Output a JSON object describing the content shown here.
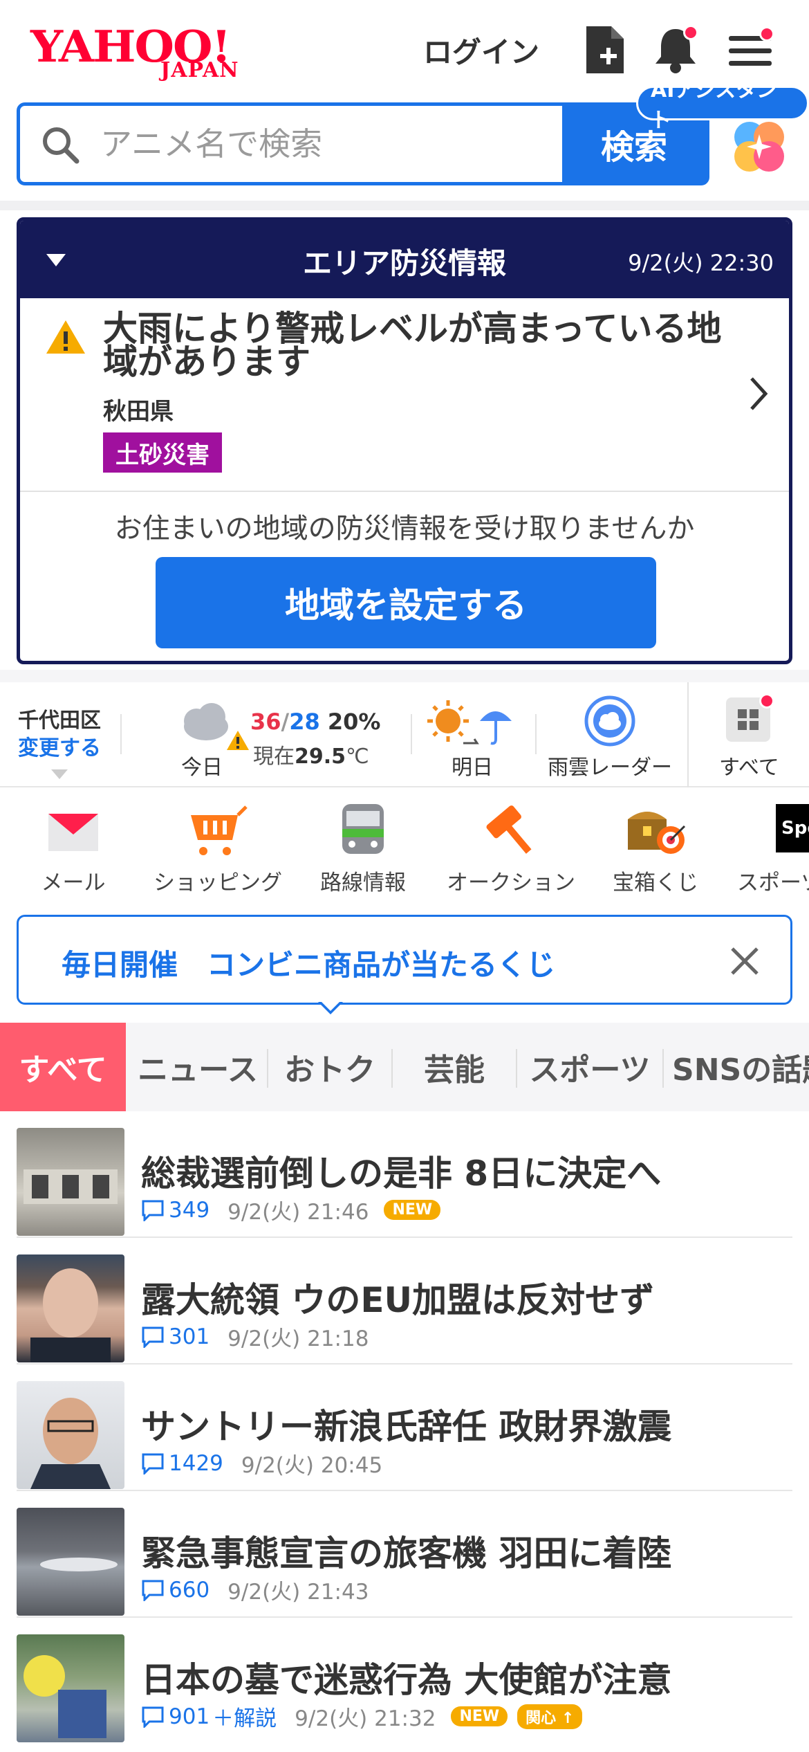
{
  "header": {
    "logo_main": "YAHOO!",
    "logo_sub": "JAPAN",
    "login_label": "ログイン"
  },
  "search": {
    "placeholder": "アニメ名で検索",
    "button_label": "検索",
    "ai_badge": "AIアシスタント"
  },
  "disaster": {
    "title": "エリア防災情報",
    "datetime": "9/2(火) 22:30",
    "message": "大雨により警戒レベルが高まっている地域があります",
    "prefecture": "秋田県",
    "tag": "土砂災害",
    "prompt": "お住まいの地域の防災情報を受け取りませんか",
    "button_label": "地域を設定する"
  },
  "weather": {
    "location": "千代田区",
    "change_label": "変更する",
    "today_label": "今日",
    "high": "36",
    "low": "28",
    "precip": "20%",
    "now_prefix": "現在",
    "now_temp": "29.5",
    "now_unit": "℃",
    "tomorrow_label": "明日",
    "radar_label": "雨雲レーダー",
    "all_label": "すべて"
  },
  "services": [
    {
      "label": "メール",
      "icon": "mail-icon"
    },
    {
      "label": "ショッピング",
      "icon": "cart-icon"
    },
    {
      "label": "路線情報",
      "icon": "train-icon"
    },
    {
      "label": "オークション",
      "icon": "auction-hammer-icon"
    },
    {
      "label": "宝箱くじ",
      "icon": "treasure-box-icon"
    },
    {
      "label": "スポーツ",
      "icon": "sports-icon"
    }
  ],
  "promo": {
    "text": "毎日開催　コンビニ商品が当たるくじ"
  },
  "tabs": [
    {
      "label": "すべて",
      "active": true
    },
    {
      "label": "ニュース"
    },
    {
      "label": "おトク"
    },
    {
      "label": "芸能"
    },
    {
      "label": "スポーツ"
    },
    {
      "label": "SNSの話題"
    }
  ],
  "news": [
    {
      "title": "総裁選前倒しの是非 8日に決定へ",
      "comments": "349",
      "time": "9/2(火) 21:46",
      "new": "NEW"
    },
    {
      "title": "露大統領 ウのEU加盟は反対せず",
      "comments": "301",
      "time": "9/2(火) 21:18"
    },
    {
      "title": "サントリー新浪氏辞任 政財界激震",
      "comments": "1429",
      "time": "9/2(火) 20:45"
    },
    {
      "title": "緊急事態宣言の旅客機 羽田に着陸",
      "comments": "660",
      "time": "9/2(火) 21:43"
    },
    {
      "title": "日本の墓で迷惑行為 大使館が注意",
      "comments": "901",
      "extra": "＋解説",
      "time": "9/2(火) 21:32",
      "new": "NEW",
      "interest": "関心"
    }
  ],
  "colors": {
    "brand_red": "#ff0033",
    "accent_blue": "#1a73e8",
    "disaster_navy": "#151a58",
    "tag_purple": "#a0109e",
    "tab_active": "#ff5c6e",
    "badge_orange": "#f6ab00"
  }
}
